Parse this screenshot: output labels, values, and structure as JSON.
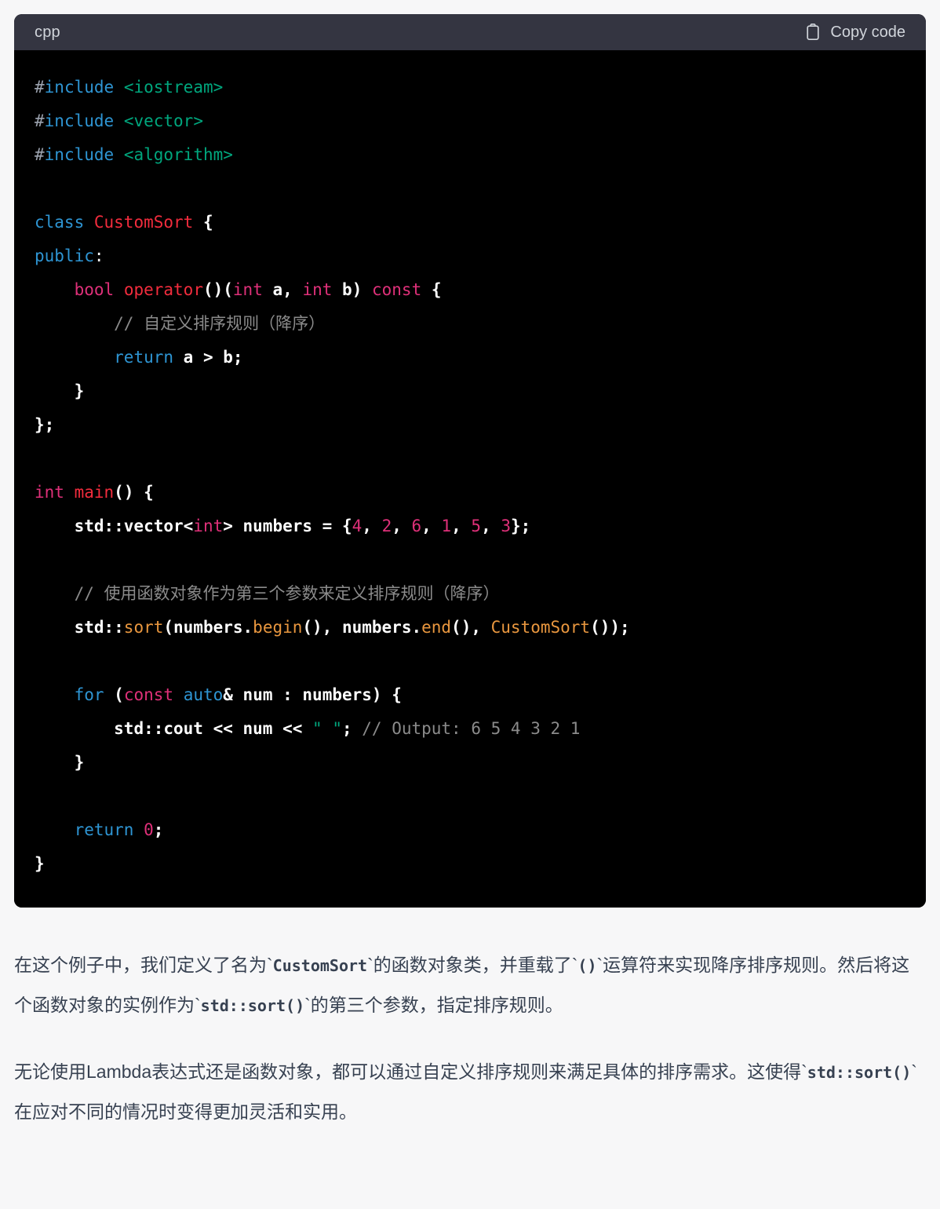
{
  "code_block": {
    "language_label": "cpp",
    "copy_label": "Copy code",
    "copy_icon": "clipboard-icon",
    "header_bg": "#343541",
    "body_bg": "#000000",
    "lines": [
      [
        {
          "t": "#",
          "c": "tok-pre"
        },
        {
          "t": "include",
          "c": "tok-kw"
        },
        {
          "t": " ",
          "c": "tok-plain"
        },
        {
          "t": "<iostream>",
          "c": "tok-str"
        }
      ],
      [
        {
          "t": "#",
          "c": "tok-pre"
        },
        {
          "t": "include",
          "c": "tok-kw"
        },
        {
          "t": " ",
          "c": "tok-plain"
        },
        {
          "t": "<vector>",
          "c": "tok-str"
        }
      ],
      [
        {
          "t": "#",
          "c": "tok-pre"
        },
        {
          "t": "include",
          "c": "tok-kw"
        },
        {
          "t": " ",
          "c": "tok-plain"
        },
        {
          "t": "<algorithm>",
          "c": "tok-str"
        }
      ],
      [],
      [
        {
          "t": "class",
          "c": "tok-kw"
        },
        {
          "t": " ",
          "c": "tok-plain"
        },
        {
          "t": "CustomSort",
          "c": "tok-cls"
        },
        {
          "t": " ",
          "c": "tok-plain"
        },
        {
          "t": "{",
          "c": "tok-plain b"
        }
      ],
      [
        {
          "t": "public",
          "c": "tok-kw"
        },
        {
          "t": ":",
          "c": "tok-plain"
        }
      ],
      [
        {
          "t": "    ",
          "c": "tok-plain"
        },
        {
          "t": "bool",
          "c": "tok-type"
        },
        {
          "t": " ",
          "c": "tok-plain"
        },
        {
          "t": "operator",
          "c": "tok-cls"
        },
        {
          "t": "()(",
          "c": "tok-plain b"
        },
        {
          "t": "int",
          "c": "tok-type"
        },
        {
          "t": " ",
          "c": "tok-plain"
        },
        {
          "t": "a",
          "c": "tok-plain b"
        },
        {
          "t": ", ",
          "c": "tok-plain b"
        },
        {
          "t": "int",
          "c": "tok-type"
        },
        {
          "t": " ",
          "c": "tok-plain"
        },
        {
          "t": "b",
          "c": "tok-plain b"
        },
        {
          "t": ") ",
          "c": "tok-plain b"
        },
        {
          "t": "const",
          "c": "tok-type"
        },
        {
          "t": " ",
          "c": "tok-plain"
        },
        {
          "t": "{",
          "c": "tok-plain b"
        }
      ],
      [
        {
          "t": "        ",
          "c": "tok-plain"
        },
        {
          "t": "// 自定义排序规则（降序）",
          "c": "tok-cmt"
        }
      ],
      [
        {
          "t": "        ",
          "c": "tok-plain"
        },
        {
          "t": "return",
          "c": "tok-kw"
        },
        {
          "t": " ",
          "c": "tok-plain"
        },
        {
          "t": "a > b;",
          "c": "tok-plain b"
        }
      ],
      [
        {
          "t": "    ",
          "c": "tok-plain"
        },
        {
          "t": "}",
          "c": "tok-plain b"
        }
      ],
      [
        {
          "t": "};",
          "c": "tok-plain b"
        }
      ],
      [],
      [
        {
          "t": "int",
          "c": "tok-type"
        },
        {
          "t": " ",
          "c": "tok-plain"
        },
        {
          "t": "main",
          "c": "tok-cls"
        },
        {
          "t": "() {",
          "c": "tok-plain b"
        }
      ],
      [
        {
          "t": "    ",
          "c": "tok-plain"
        },
        {
          "t": "std::vector<",
          "c": "tok-plain b"
        },
        {
          "t": "int",
          "c": "tok-type"
        },
        {
          "t": "> numbers = {",
          "c": "tok-plain b"
        },
        {
          "t": "4",
          "c": "tok-type"
        },
        {
          "t": ", ",
          "c": "tok-plain b"
        },
        {
          "t": "2",
          "c": "tok-type"
        },
        {
          "t": ", ",
          "c": "tok-plain b"
        },
        {
          "t": "6",
          "c": "tok-type"
        },
        {
          "t": ", ",
          "c": "tok-plain b"
        },
        {
          "t": "1",
          "c": "tok-type"
        },
        {
          "t": ", ",
          "c": "tok-plain b"
        },
        {
          "t": "5",
          "c": "tok-type"
        },
        {
          "t": ", ",
          "c": "tok-plain b"
        },
        {
          "t": "3",
          "c": "tok-type"
        },
        {
          "t": "};",
          "c": "tok-plain b"
        }
      ],
      [],
      [
        {
          "t": "    ",
          "c": "tok-plain"
        },
        {
          "t": "// 使用函数对象作为第三个参数来定义排序规则（降序）",
          "c": "tok-cmt"
        }
      ],
      [
        {
          "t": "    ",
          "c": "tok-plain"
        },
        {
          "t": "std::",
          "c": "tok-plain b"
        },
        {
          "t": "sort",
          "c": "tok-fn"
        },
        {
          "t": "(numbers.",
          "c": "tok-plain b"
        },
        {
          "t": "begin",
          "c": "tok-fn"
        },
        {
          "t": "(), numbers.",
          "c": "tok-plain b"
        },
        {
          "t": "end",
          "c": "tok-fn"
        },
        {
          "t": "(), ",
          "c": "tok-plain b"
        },
        {
          "t": "CustomSort",
          "c": "tok-fn"
        },
        {
          "t": "());",
          "c": "tok-plain b"
        }
      ],
      [],
      [
        {
          "t": "    ",
          "c": "tok-plain"
        },
        {
          "t": "for",
          "c": "tok-kw"
        },
        {
          "t": " (",
          "c": "tok-plain b"
        },
        {
          "t": "const",
          "c": "tok-type"
        },
        {
          "t": " ",
          "c": "tok-plain"
        },
        {
          "t": "auto",
          "c": "tok-kw"
        },
        {
          "t": "& num : numbers) {",
          "c": "tok-plain b"
        }
      ],
      [
        {
          "t": "        ",
          "c": "tok-plain"
        },
        {
          "t": "std::cout << num << ",
          "c": "tok-plain b"
        },
        {
          "t": "\" \"",
          "c": "tok-str"
        },
        {
          "t": "; ",
          "c": "tok-plain b"
        },
        {
          "t": "// Output: 6 5 4 3 2 1",
          "c": "tok-cmt"
        }
      ],
      [
        {
          "t": "    ",
          "c": "tok-plain"
        },
        {
          "t": "}",
          "c": "tok-plain b"
        }
      ],
      [],
      [
        {
          "t": "    ",
          "c": "tok-plain"
        },
        {
          "t": "return",
          "c": "tok-kw"
        },
        {
          "t": " ",
          "c": "tok-plain"
        },
        {
          "t": "0",
          "c": "tok-type"
        },
        {
          "t": ";",
          "c": "tok-plain b"
        }
      ],
      [
        {
          "t": "}",
          "c": "tok-plain b"
        }
      ]
    ]
  },
  "prose": {
    "paragraphs": [
      [
        {
          "t": "在这个例子中，我们定义了名为`",
          "k": "text"
        },
        {
          "t": "CustomSort",
          "k": "code"
        },
        {
          "t": "`的函数对象类，并重载了`",
          "k": "text"
        },
        {
          "t": "()",
          "k": "code"
        },
        {
          "t": "`运算符来实现降序排序规则。然后将这个函数对象的实例作为`",
          "k": "text"
        },
        {
          "t": "std::sort()",
          "k": "code"
        },
        {
          "t": "`的第三个参数，指定排序规则。",
          "k": "text"
        }
      ],
      [
        {
          "t": "无论使用Lambda表达式还是函数对象，都可以通过自定义排序规则来满足具体的排序需求。这使得`",
          "k": "text"
        },
        {
          "t": "std::sort()",
          "k": "code"
        },
        {
          "t": "`在应对不同的情况时变得更加灵活和实用。",
          "k": "text"
        }
      ]
    ]
  },
  "colors": {
    "page_bg": "#f7f7f8",
    "header_bg": "#343541",
    "code_bg": "#000000",
    "text": "#374151",
    "keyword": "#2e95d3",
    "string": "#00a67d",
    "type": "#df3079",
    "class": "#f22c3d",
    "function": "#e9973f",
    "comment": "#8b8b8b"
  }
}
